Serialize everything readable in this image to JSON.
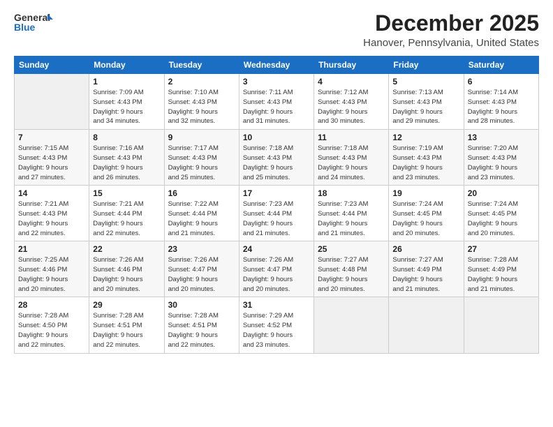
{
  "header": {
    "logo_general": "General",
    "logo_blue": "Blue",
    "month": "December 2025",
    "location": "Hanover, Pennsylvania, United States"
  },
  "weekdays": [
    "Sunday",
    "Monday",
    "Tuesday",
    "Wednesday",
    "Thursday",
    "Friday",
    "Saturday"
  ],
  "weeks": [
    [
      {
        "day": "",
        "info": ""
      },
      {
        "day": "1",
        "info": "Sunrise: 7:09 AM\nSunset: 4:43 PM\nDaylight: 9 hours\nand 34 minutes."
      },
      {
        "day": "2",
        "info": "Sunrise: 7:10 AM\nSunset: 4:43 PM\nDaylight: 9 hours\nand 32 minutes."
      },
      {
        "day": "3",
        "info": "Sunrise: 7:11 AM\nSunset: 4:43 PM\nDaylight: 9 hours\nand 31 minutes."
      },
      {
        "day": "4",
        "info": "Sunrise: 7:12 AM\nSunset: 4:43 PM\nDaylight: 9 hours\nand 30 minutes."
      },
      {
        "day": "5",
        "info": "Sunrise: 7:13 AM\nSunset: 4:43 PM\nDaylight: 9 hours\nand 29 minutes."
      },
      {
        "day": "6",
        "info": "Sunrise: 7:14 AM\nSunset: 4:43 PM\nDaylight: 9 hours\nand 28 minutes."
      }
    ],
    [
      {
        "day": "7",
        "info": "Sunrise: 7:15 AM\nSunset: 4:43 PM\nDaylight: 9 hours\nand 27 minutes."
      },
      {
        "day": "8",
        "info": "Sunrise: 7:16 AM\nSunset: 4:43 PM\nDaylight: 9 hours\nand 26 minutes."
      },
      {
        "day": "9",
        "info": "Sunrise: 7:17 AM\nSunset: 4:43 PM\nDaylight: 9 hours\nand 25 minutes."
      },
      {
        "day": "10",
        "info": "Sunrise: 7:18 AM\nSunset: 4:43 PM\nDaylight: 9 hours\nand 25 minutes."
      },
      {
        "day": "11",
        "info": "Sunrise: 7:18 AM\nSunset: 4:43 PM\nDaylight: 9 hours\nand 24 minutes."
      },
      {
        "day": "12",
        "info": "Sunrise: 7:19 AM\nSunset: 4:43 PM\nDaylight: 9 hours\nand 23 minutes."
      },
      {
        "day": "13",
        "info": "Sunrise: 7:20 AM\nSunset: 4:43 PM\nDaylight: 9 hours\nand 23 minutes."
      }
    ],
    [
      {
        "day": "14",
        "info": "Sunrise: 7:21 AM\nSunset: 4:43 PM\nDaylight: 9 hours\nand 22 minutes."
      },
      {
        "day": "15",
        "info": "Sunrise: 7:21 AM\nSunset: 4:44 PM\nDaylight: 9 hours\nand 22 minutes."
      },
      {
        "day": "16",
        "info": "Sunrise: 7:22 AM\nSunset: 4:44 PM\nDaylight: 9 hours\nand 21 minutes."
      },
      {
        "day": "17",
        "info": "Sunrise: 7:23 AM\nSunset: 4:44 PM\nDaylight: 9 hours\nand 21 minutes."
      },
      {
        "day": "18",
        "info": "Sunrise: 7:23 AM\nSunset: 4:44 PM\nDaylight: 9 hours\nand 21 minutes."
      },
      {
        "day": "19",
        "info": "Sunrise: 7:24 AM\nSunset: 4:45 PM\nDaylight: 9 hours\nand 20 minutes."
      },
      {
        "day": "20",
        "info": "Sunrise: 7:24 AM\nSunset: 4:45 PM\nDaylight: 9 hours\nand 20 minutes."
      }
    ],
    [
      {
        "day": "21",
        "info": "Sunrise: 7:25 AM\nSunset: 4:46 PM\nDaylight: 9 hours\nand 20 minutes."
      },
      {
        "day": "22",
        "info": "Sunrise: 7:26 AM\nSunset: 4:46 PM\nDaylight: 9 hours\nand 20 minutes."
      },
      {
        "day": "23",
        "info": "Sunrise: 7:26 AM\nSunset: 4:47 PM\nDaylight: 9 hours\nand 20 minutes."
      },
      {
        "day": "24",
        "info": "Sunrise: 7:26 AM\nSunset: 4:47 PM\nDaylight: 9 hours\nand 20 minutes."
      },
      {
        "day": "25",
        "info": "Sunrise: 7:27 AM\nSunset: 4:48 PM\nDaylight: 9 hours\nand 20 minutes."
      },
      {
        "day": "26",
        "info": "Sunrise: 7:27 AM\nSunset: 4:49 PM\nDaylight: 9 hours\nand 21 minutes."
      },
      {
        "day": "27",
        "info": "Sunrise: 7:28 AM\nSunset: 4:49 PM\nDaylight: 9 hours\nand 21 minutes."
      }
    ],
    [
      {
        "day": "28",
        "info": "Sunrise: 7:28 AM\nSunset: 4:50 PM\nDaylight: 9 hours\nand 22 minutes."
      },
      {
        "day": "29",
        "info": "Sunrise: 7:28 AM\nSunset: 4:51 PM\nDaylight: 9 hours\nand 22 minutes."
      },
      {
        "day": "30",
        "info": "Sunrise: 7:28 AM\nSunset: 4:51 PM\nDaylight: 9 hours\nand 22 minutes."
      },
      {
        "day": "31",
        "info": "Sunrise: 7:29 AM\nSunset: 4:52 PM\nDaylight: 9 hours\nand 23 minutes."
      },
      {
        "day": "",
        "info": ""
      },
      {
        "day": "",
        "info": ""
      },
      {
        "day": "",
        "info": ""
      }
    ]
  ]
}
